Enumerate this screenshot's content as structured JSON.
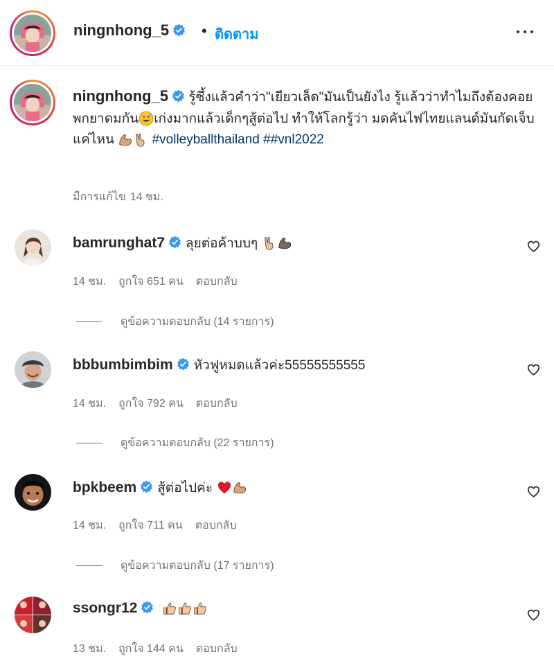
{
  "header": {
    "username": "ningnhong_5",
    "separator": "•",
    "follow_label": "ติดตาม"
  },
  "caption": {
    "username": "ningnhong_5",
    "text_part1": "รู้ซึ้งแล้วคำว่า\"เยียวเล็ด\"มันเป็นยังไง รู้แล้วว่าทำไมถึงต้องคอยพกยาดมกัน",
    "text_part2": "เก่งมากแล้วเด็กๆสู้ต่อไป ทำให้โลกรู้ว่า มดคันไฟไทยแลนด์มันกัดเจ็บแค่ไหน ",
    "hashtag1": "#volleyballthailand",
    "hashtag2": "##vnl2022",
    "edited_label": "มีการแก้ไข",
    "time": "14 ชม."
  },
  "comments": [
    {
      "username": "bamrunghat7",
      "text": "ลุยต่อค้าบบๆ",
      "time": "14 ชม.",
      "likes": "ถูกใจ 651 คน",
      "reply_label": "ตอบกลับ",
      "view_replies": "ดูข้อความตอบกลับ (14 รายการ)"
    },
    {
      "username": "bbbumbimbim",
      "text": "หัวฟูหมดแล้วค่ะ55555555555",
      "time": "14 ชม.",
      "likes": "ถูกใจ 792 คน",
      "reply_label": "ตอบกลับ",
      "view_replies": "ดูข้อความตอบกลับ (22 รายการ)"
    },
    {
      "username": "bpkbeem",
      "text": "สู้ต่อไปค่ะ",
      "time": "14 ชม.",
      "likes": "ถูกใจ 711 คน",
      "reply_label": "ตอบกลับ",
      "view_replies": "ดูข้อความตอบกลับ (17 รายการ)"
    },
    {
      "username": "ssongr12",
      "text": "",
      "time": "13 ชม.",
      "likes": "ถูกใจ 144 คน",
      "reply_label": "ตอบกลับ"
    }
  ],
  "icons": {
    "verified": "verified-badge-icon",
    "more": "more-options-icon",
    "like": "heart-icon",
    "emoji_sweat": "grinning-sweat-emoji",
    "emoji_muscle": "flexed-biceps-emoji",
    "emoji_victory": "victory-hand-emoji",
    "emoji_heart": "red-heart-emoji",
    "emoji_thumbs": "thumbs-up-emoji"
  },
  "colors": {
    "link": "#0095f6",
    "hashtag": "#00376b",
    "verified": "#3897f0",
    "muted": "#737373",
    "text": "#262626"
  }
}
